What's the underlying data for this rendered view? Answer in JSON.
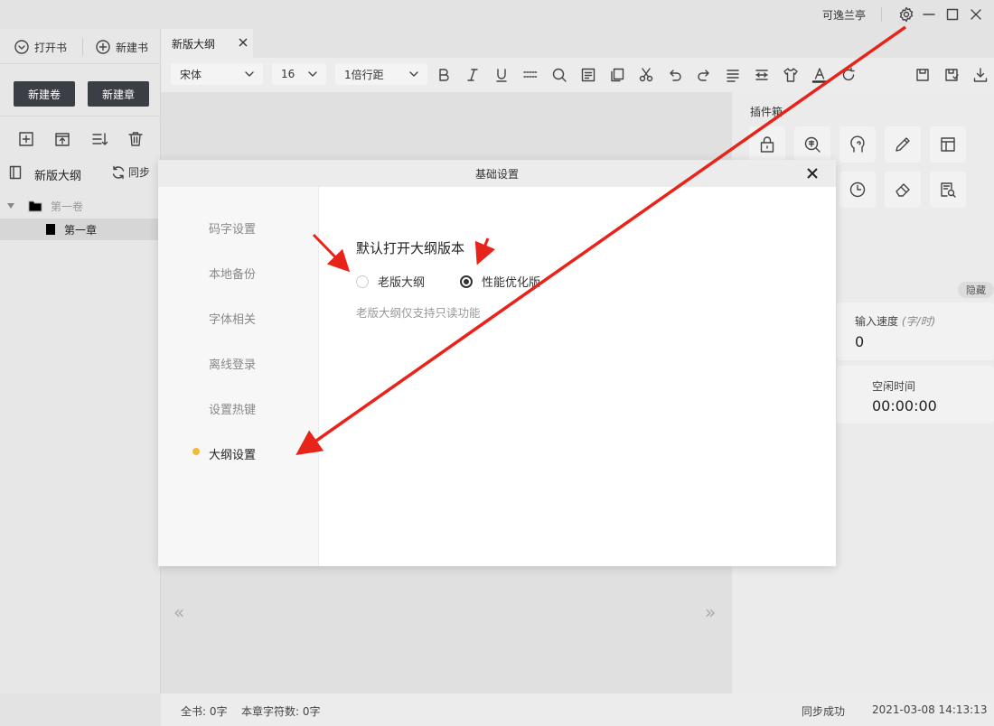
{
  "titlebar": {
    "user": "可逸兰亭"
  },
  "sidebar": {
    "open_book": "打开书",
    "new_book": "新建书",
    "new_volume": "新建卷",
    "new_chapter": "新建章",
    "outline_label": "新版大纲",
    "sync_label": "同步",
    "tree": [
      {
        "label": "第一卷"
      },
      {
        "label": "第一章"
      }
    ]
  },
  "tabs": [
    {
      "label": "新版大纲"
    }
  ],
  "toolbar": {
    "font": "宋体",
    "size": "16",
    "line_spacing": "1倍行距"
  },
  "right_panel": {
    "plugins_title": "插件箱",
    "hide_label": "隐藏",
    "speed_label": "输入速度",
    "speed_unit": "(字/时)",
    "speed_value": "0",
    "idle_label": "空闲时间",
    "idle_value": "00:00:00"
  },
  "editor": {
    "prev": "«",
    "next": "»"
  },
  "statusbar": {
    "total": "全书: 0字",
    "chapter": "本章字符数: 0字",
    "sync": "同步成功",
    "datetime": "2021-03-08 14:13:13"
  },
  "modal": {
    "title": "基础设置",
    "nav": [
      {
        "label": "码字设置"
      },
      {
        "label": "本地备份"
      },
      {
        "label": "字体相关"
      },
      {
        "label": "离线登录"
      },
      {
        "label": "设置热键"
      },
      {
        "label": "大纲设置",
        "active": true
      }
    ],
    "section_title": "默认打开大纲版本",
    "options": [
      {
        "label": "老版大纲",
        "selected": false
      },
      {
        "label": "性能优化版",
        "selected": true
      }
    ],
    "hint": "老版大纲仅支持只读功能"
  },
  "colors": {
    "accent_dot": "#f5b93a",
    "dark_button": "#3b3f45",
    "arrow": "#e8231a"
  }
}
